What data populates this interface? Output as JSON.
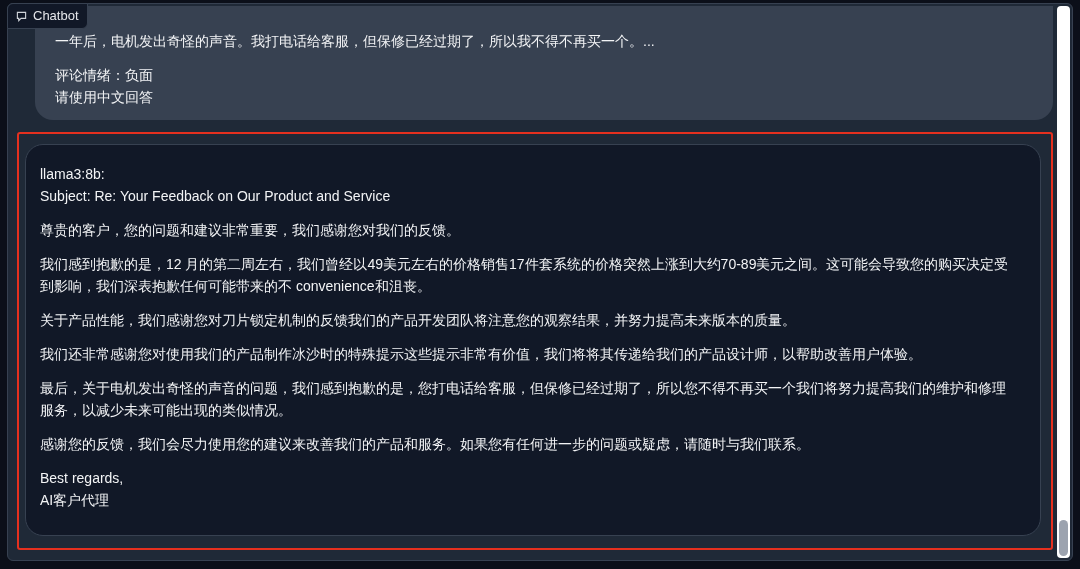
{
  "panel": {
    "label": "Chatbot"
  },
  "messages": [
    {
      "kind": "user",
      "highlighted": false,
      "paragraphs": [
        [
          "一年后，电机发出奇怪的声音。我打电话给客服，但保修已经过期了，所以我不得不再买一个。..."
        ],
        [
          "评论情绪：负面",
          "请使用中文回答"
        ]
      ]
    },
    {
      "kind": "bot",
      "highlighted": true,
      "paragraphs": [
        [
          "llama3:8b:",
          "Subject: Re: Your Feedback on Our Product and Service"
        ],
        [
          "尊贵的客户，您的问题和建议非常重要，我们感谢您对我们的反馈。"
        ],
        [
          "我们感到抱歉的是，12 月的第二周左右，我们曾经以49美元左右的价格销售17件套系统的价格突然上涨到大约70-89美元之间。这可能会导致您的购买决定受到影响，我们深表抱歉任何可能带来的不 convenience和沮丧。"
        ],
        [
          "关于产品性能，我们感谢您对刀片锁定机制的反馈我们的产品开发团队将注意您的观察结果，并努力提高未来版本的质量。"
        ],
        [
          "我们还非常感谢您对使用我们的产品制作冰沙时的特殊提示这些提示非常有价值，我们将将其传递给我们的产品设计师，以帮助改善用户体验。"
        ],
        [
          "最后，关于电机发出奇怪的声音的问题，我们感到抱歉的是，您打电话给客服，但保修已经过期了，所以您不得不再买一个我们将努力提高我们的维护和修理服务，以减少未来可能出现的类似情况。"
        ],
        [
          "感谢您的反馈，我们会尽力使用您的建议来改善我们的产品和服务。如果您有任何进一步的问题或疑虑，请随时与我们联系。"
        ],
        [
          "Best regards,",
          "AI客户代理"
        ]
      ]
    }
  ]
}
